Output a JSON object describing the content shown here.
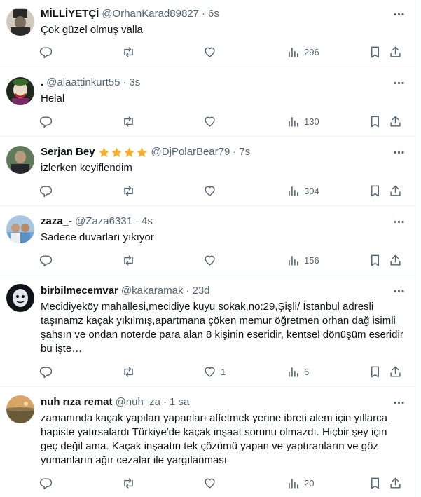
{
  "tweets": [
    {
      "name": "MİLLİYETÇİ",
      "handle": "@OrhanKarad89827",
      "time": "6s",
      "text": "Çok güzel olmuş valla",
      "replies": "",
      "retweets": "",
      "likes": "",
      "views": "296"
    },
    {
      "name": ".",
      "handle": "@alaattinkurt55",
      "time": "3s",
      "text": "Helal",
      "replies": "",
      "retweets": "",
      "likes": "",
      "views": "130"
    },
    {
      "name": "Serjan Bey",
      "handle": "@DjPolarBear79",
      "time": "7s",
      "text": "izlerken keyiflendim",
      "replies": "",
      "retweets": "",
      "likes": "",
      "views": "304"
    },
    {
      "name": "zaza_-",
      "handle": "@Zaza6331",
      "time": "4s",
      "text": "Sadece duvarları yıkıyor",
      "replies": "",
      "retweets": "",
      "likes": "",
      "views": "156"
    },
    {
      "name": "birbilmecemvar",
      "handle": "@kakaramak",
      "time": "23d",
      "text": "Mecidiyeköy mahallesi,mecidiye kuyu sokak,no:29,Şişli/ İstanbul adresli taşınamz kaçak yıkılmış,apartmana çöken memur öğretmen orhan dağ isimli şahsın ve ondan noterde para alan 8 kişinin eseridir, kentsel dönüşüm eseridir bu işte…",
      "replies": "",
      "retweets": "",
      "likes": "1",
      "views": "6"
    },
    {
      "name": "nuh rıza remat",
      "handle": "@nuh_za",
      "time": "1 sa",
      "text": "zamanında kaçak yapıları yapanları affetmek yerine ibreti alem için yıllarca hapiste yatırsalardı Türkiye'de kaçak inşaat sorunu olmazdı. Hiçbir şey için geç değil ama. Kaçak inşaatın tek çözümü yapan ve yaptıranların ve göz yumanların ağır cezalar ile yargılanması",
      "replies": "",
      "retweets": "",
      "likes": "",
      "views": "20"
    }
  ],
  "colors": {
    "text": "#0f1419",
    "secondary": "#536471",
    "star": "#ffad1f",
    "divider": "#eff3f4"
  },
  "icons": [
    "reply-icon",
    "retweet-icon",
    "like-icon",
    "views-icon",
    "bookmark-icon",
    "share-icon",
    "more-icon",
    "star-icon"
  ]
}
